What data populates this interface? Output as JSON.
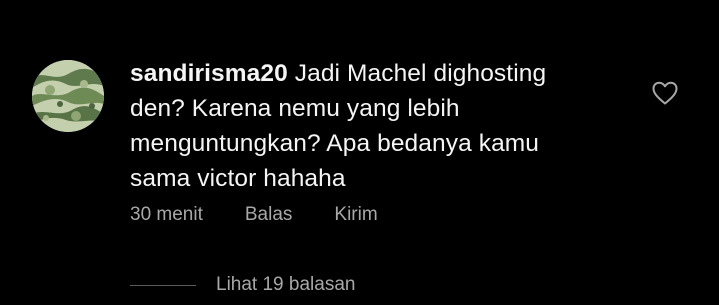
{
  "comment": {
    "username": "sandirisma20",
    "text": "Jadi Machel dighosting den? Karena nemu yang lebih menguntungkan? Apa bedanya kamu sama victor hahaha",
    "time": "30 menit",
    "reply_label": "Balas",
    "send_label": "Kirim",
    "like_icon": "heart-outline-icon"
  },
  "replies": {
    "view_label": "Lihat 19 balasan"
  },
  "colors": {
    "background": "#000000",
    "text_primary": "#f5f5f5",
    "text_secondary": "#a8a8a8"
  }
}
